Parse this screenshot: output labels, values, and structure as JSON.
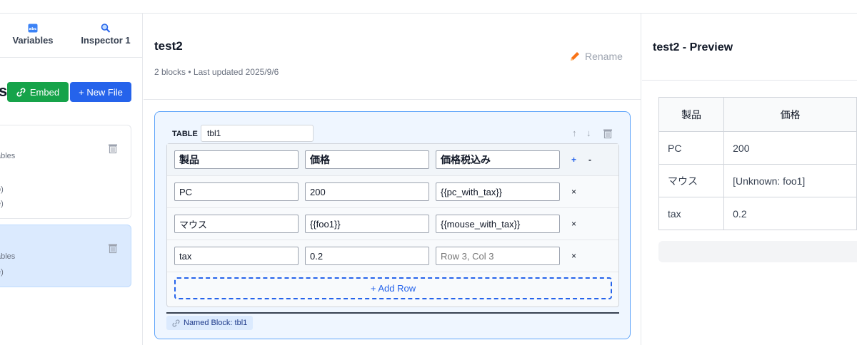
{
  "left": {
    "tabs": [
      {
        "label": "Variables",
        "icon": "abc-icon"
      },
      {
        "label": "Inspector 1",
        "icon": "magnifier-icon"
      }
    ],
    "heading_fragment": "s",
    "embed_label": "Embed",
    "new_file_label": "+ New File",
    "card1": {
      "frag1": "ables",
      "frag2": "o)",
      "frag3": "e)"
    },
    "card2": {
      "frag1": "ables",
      "frag2": "e)"
    }
  },
  "doc": {
    "title": "test2",
    "subtitle": "2 blocks • Last updated 2025/9/6",
    "rename_label": "Rename"
  },
  "block": {
    "type_label": "TABLE",
    "name": "tbl1",
    "header": [
      "製品",
      "価格",
      "価格税込み"
    ],
    "header_add": "+",
    "header_remove": "-",
    "rows": [
      {
        "cells": [
          "PC",
          "200",
          "{{pc_with_tax}}"
        ]
      },
      {
        "cells": [
          "マウス",
          "{{foo1}}",
          "{{mouse_with_tax}}"
        ]
      },
      {
        "cells": [
          "tax",
          "0.2",
          ""
        ],
        "placeholder": "Row 3, Col 3"
      }
    ],
    "row_delete": "×",
    "add_row_label": "+ Add Row",
    "named_block_label": "Named Block: tbl1"
  },
  "preview": {
    "title": "test2 - Preview",
    "header": [
      "製品",
      "価格"
    ],
    "rows": [
      [
        "PC",
        "200"
      ],
      [
        "マウス",
        "[Unknown: foo1]"
      ],
      [
        "tax",
        "0.2"
      ]
    ]
  },
  "colors": {
    "accent": "#2563eb",
    "embed": "#16a34a",
    "block_border": "#60a5fa",
    "block_bg": "#eff6ff"
  }
}
